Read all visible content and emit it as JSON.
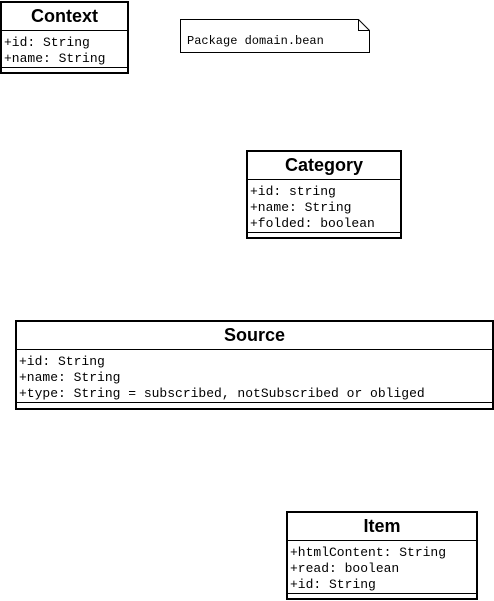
{
  "note": {
    "text": "Package domain.bean"
  },
  "classes": {
    "context": {
      "name": "Context",
      "attributes": [
        "+id: String",
        "+name: String"
      ]
    },
    "category": {
      "name": "Category",
      "attributes": [
        "+id: string",
        "+name: String",
        "+folded: boolean"
      ]
    },
    "source": {
      "name": "Source",
      "attributes": [
        "+id: String",
        "+name: String",
        "+type: String = subscribed, notSubscribed or obliged"
      ]
    },
    "item": {
      "name": "Item",
      "attributes": [
        "+htmlContent: String",
        "+read: boolean",
        "+id: String"
      ]
    }
  }
}
